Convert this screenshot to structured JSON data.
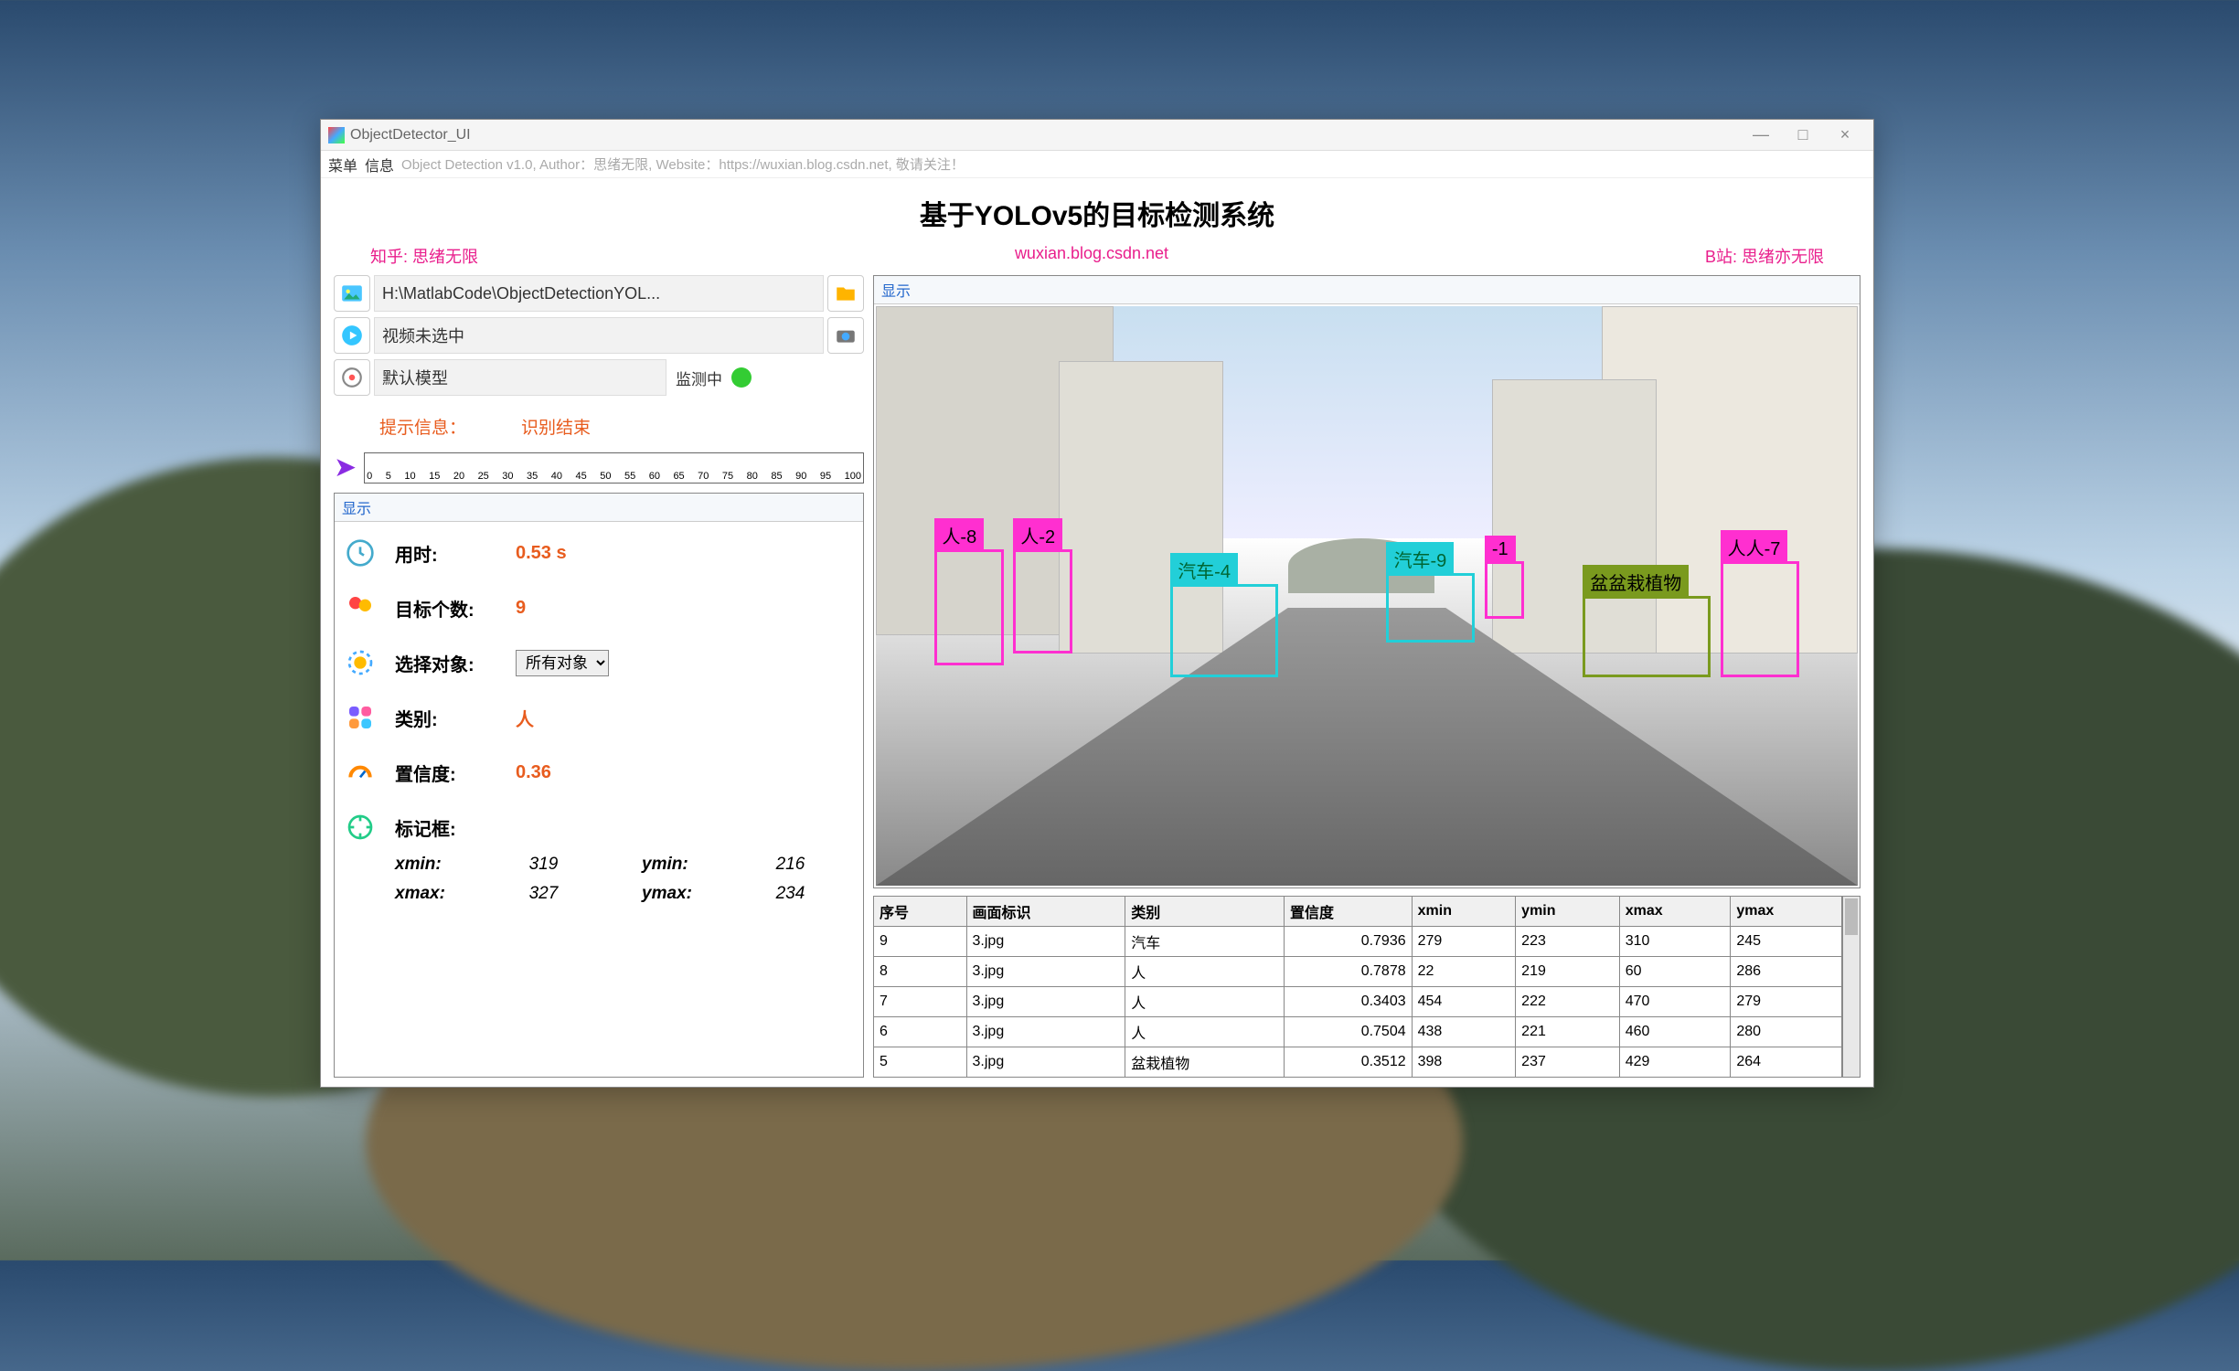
{
  "window": {
    "title": "ObjectDetector_UI",
    "min": "—",
    "max": "□",
    "close": "×"
  },
  "menu": {
    "item1": "菜单",
    "item2": "信息",
    "status": "Object Detection v1.0, Author：思绪无限, Website：https://wuxian.blog.csdn.net, 敬请关注！"
  },
  "heading": "基于YOLOv5的目标检测系统",
  "links": {
    "left": "知乎: 思绪无限",
    "center": "wuxian.blog.csdn.net",
    "right": "B站: 思绪亦无限"
  },
  "inputs": {
    "image_path": "H:\\MatlabCode\\ObjectDetectionYOL...",
    "video_status": "视频未选中",
    "model_name": "默认模型",
    "monitor_label": "监测中"
  },
  "hints": {
    "label": "提示信息：",
    "value": "识别结束"
  },
  "left_panel_title": "显示",
  "right_panel_title": "显示",
  "stats": {
    "time_label": "用时:",
    "time_value": "0.53 s",
    "count_label": "目标个数:",
    "count_value": "9",
    "select_label": "选择对象:",
    "select_value": "所有对象",
    "class_label": "类别:",
    "class_value": "人",
    "conf_label": "置信度:",
    "conf_value": "0.36",
    "bbox_label": "标记框:",
    "xmin_k": "xmin:",
    "xmin_v": "319",
    "ymin_k": "ymin:",
    "ymin_v": "216",
    "xmax_k": "xmax:",
    "xmax_v": "327",
    "ymax_k": "ymax:",
    "ymax_v": "234"
  },
  "detections": [
    {
      "cls": "人-8",
      "color": "magenta",
      "l": 6,
      "t": 42,
      "w": 7,
      "h": 20
    },
    {
      "cls": "人-2",
      "color": "magenta",
      "l": 14,
      "t": 42,
      "w": 6,
      "h": 18
    },
    {
      "cls": "汽车-4",
      "color": "cyan",
      "l": 30,
      "t": 48,
      "w": 11,
      "h": 16
    },
    {
      "cls": "汽车-9",
      "color": "cyan",
      "l": 52,
      "t": 46,
      "w": 9,
      "h": 12
    },
    {
      "cls": "-1",
      "color": "magenta",
      "l": 62,
      "t": 44,
      "w": 4,
      "h": 10
    },
    {
      "cls": "盆盆栽植物",
      "color": "olive",
      "l": 72,
      "t": 50,
      "w": 13,
      "h": 14
    },
    {
      "cls": "人人-7",
      "color": "magenta",
      "l": 86,
      "t": 44,
      "w": 8,
      "h": 20
    }
  ],
  "table": {
    "headers": [
      "序号",
      "画面标识",
      "类别",
      "置信度",
      "xmin",
      "ymin",
      "xmax",
      "ymax"
    ],
    "rows": [
      [
        "9",
        "3.jpg",
        "汽车",
        "0.7936",
        "279",
        "223",
        "310",
        "245"
      ],
      [
        "8",
        "3.jpg",
        "人",
        "0.7878",
        "22",
        "219",
        "60",
        "286"
      ],
      [
        "7",
        "3.jpg",
        "人",
        "0.3403",
        "454",
        "222",
        "470",
        "279"
      ],
      [
        "6",
        "3.jpg",
        "人",
        "0.7504",
        "438",
        "221",
        "460",
        "280"
      ],
      [
        "5",
        "3.jpg",
        "盆栽植物",
        "0.3512",
        "398",
        "237",
        "429",
        "264"
      ]
    ]
  },
  "ruler_ticks": [
    "0",
    "5",
    "10",
    "15",
    "20",
    "25",
    "30",
    "35",
    "40",
    "45",
    "50",
    "55",
    "60",
    "65",
    "70",
    "75",
    "80",
    "85",
    "90",
    "95",
    "100"
  ]
}
